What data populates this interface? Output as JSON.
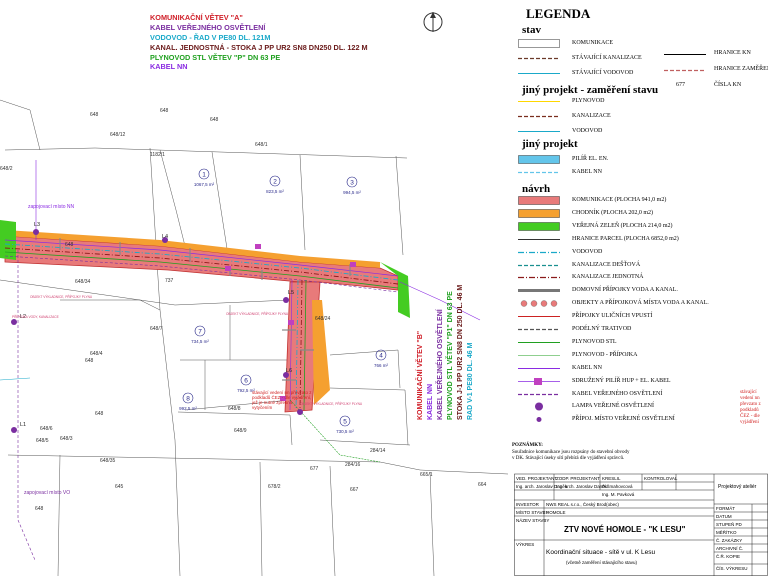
{
  "title_lines": [
    {
      "text": "KOMUNIKAČNÍ VĚTEV \"A\"",
      "color": "#d0202a"
    },
    {
      "text": "KABEL VEŘEJNÉHO OSVĚTLENÍ",
      "color": "#7a2ea0"
    },
    {
      "text": "VODOVOD - ŘAD V PE80 DL. 121M",
      "color": "#1aa9c9"
    },
    {
      "text": "KANAL. JEDNOSTNÁ - STOKA J PP UR2 SN8 DN250 DL. 122 M",
      "color": "#6a1a1a"
    },
    {
      "text": "PLYNOVOD STL VĚTEV \"P\" DN 63 PE",
      "color": "#20a020"
    },
    {
      "text": "KABEL NN",
      "color": "#8a2be2"
    }
  ],
  "vertical_lines": [
    {
      "text": "KOMUNIKAČNÍ VĚTEV \"B\"",
      "color": "#d0202a"
    },
    {
      "text": "KABEL NN",
      "color": "#8a2be2"
    },
    {
      "text": "KABEL VEŘEJNÉHO OSVĚTLENÍ",
      "color": "#7a2ea0"
    },
    {
      "text": "PLYNOVOD STL VĚTEV \"P1\" DN 63 PE",
      "color": "#20a020"
    },
    {
      "text": "STOKA J-1 PP UR2 SN8 DN 250 DL. 46 M",
      "color": "#6a1a1a"
    },
    {
      "text": "RAD V-1 PE80 DL. 46 M",
      "color": "#1aa9c9"
    }
  ],
  "plots": [
    {
      "num": "1",
      "area": "1067,5 m²"
    },
    {
      "num": "2",
      "area": "823,5 m²"
    },
    {
      "num": "3",
      "area": "994,5 m²"
    },
    {
      "num": "4",
      "area": "766 m²"
    },
    {
      "num": "5",
      "area": "730,5 m²"
    },
    {
      "num": "6",
      "area": "792,5 m²"
    },
    {
      "num": "7",
      "area": "734,5 m²"
    },
    {
      "num": "8",
      "area": "992,5 m²"
    }
  ],
  "parcel_labels": [
    "648",
    "648",
    "1182/1",
    "648/12",
    "648/2",
    "648",
    "648/1",
    "648",
    "648/34",
    "648/7",
    "648/4",
    "648/3",
    "737",
    "648/24",
    "648",
    "648/35",
    "648",
    "648/8",
    "648/9",
    "678/2",
    "677",
    "665/1",
    "664",
    "648/6",
    "648/5",
    "284/16",
    "284/14",
    "667",
    "648",
    "645"
  ],
  "map_notes": {
    "nn_top": "zapojovací místo NN",
    "vo_bottom": "zapojovací místo VO",
    "l_labels": [
      "L1",
      "L2",
      "L3",
      "L4",
      "L5",
      "L6"
    ],
    "red_note": "stávající vedení nn převzato z podkladů ČEZ - dle vyjádření, jež je nutné zpřesnit vytyčením",
    "pink1": "OBJEKT VÝKLADNICE, PŘÍPOJKY PLYNU",
    "pink2": "OBJEKT VÝKLADNICE, PŘÍPOJKY PLYNU",
    "pink3": "PŘÍPOJKA VODY, KANALIZACE",
    "pink4": "OBJEKT VÝKLADNICE, PŘÍPOJKY PLYNU"
  },
  "legend": {
    "title": "LEGENDA",
    "sec_stav": "stav",
    "stav": [
      {
        "label": "KOMUNIKACE",
        "color": "#ffffff",
        "border": "#333",
        "style": "box"
      },
      {
        "label": "STÁVAJÍCÍ KANALIZACE",
        "color": "#6b3a2a",
        "style": "dash"
      },
      {
        "label": "STÁVAJÍCÍ VODOVOD",
        "color": "#1aa9c9",
        "style": "line"
      }
    ],
    "stav_side": [
      {
        "label": "HRANICE KN",
        "color": "#000",
        "style": "line"
      },
      {
        "label": "HRANICE ZAMĚŘENÍ",
        "color": "#c06060",
        "style": "dash"
      },
      {
        "label": "ČÍSLA KN",
        "sample": "677"
      }
    ],
    "sec_jiny": "jiný projekt - zaměření stavu",
    "jiny": [
      {
        "label": "PLYNOVOD",
        "color": "#ffd700",
        "style": "line"
      },
      {
        "label": "KANALIZACE",
        "color": "#7a2e1e",
        "style": "dash"
      },
      {
        "label": "VODOVOD",
        "color": "#1aa9c9",
        "style": "line"
      }
    ],
    "sec_jiny2": "jiný projekt",
    "jiny2": [
      {
        "label": "PILÍŘ EL. EN.",
        "color": "#63c5ea",
        "style": "box"
      },
      {
        "label": "KABEL NN",
        "color": "#63c5ea",
        "style": "dash"
      }
    ],
    "sec_navrh": "návrh",
    "navrh": [
      {
        "label": "KOMUNIKACE (PLOCHA 941,0 m2)",
        "color": "#e87a7a",
        "style": "box"
      },
      {
        "label": "CHODNÍK (PLOCHA 202,0 m2)",
        "color": "#f5a030",
        "style": "box"
      },
      {
        "label": "VEŘEJNÁ ZELEŇ (PLOCHA 214,0 m2)",
        "color": "#44cc22",
        "style": "box"
      },
      {
        "label": "HRANICE PARCEL (PLOCHA 6852,0 m2)",
        "color": "#333",
        "style": "line"
      },
      {
        "label": "VODOVOD",
        "color": "#1aa9c9",
        "style": "dashdot"
      },
      {
        "label": "KANALIZACE DEŠŤOVÁ",
        "color": "#1a9090",
        "style": "dash"
      },
      {
        "label": "KANALIZACE JEDNOTNÁ",
        "color": "#8b1a1a",
        "style": "dashdot"
      },
      {
        "label": "DOMOVNÍ PŘÍPOJKY VODA A KANAL.",
        "color": "#777",
        "style": "thick"
      },
      {
        "label": "OBJEKTY A PŘÍPOJKOVÁ MÍSTA VODA A KANAL.",
        "color": "#e87a7a",
        "style": "circles"
      },
      {
        "label": "PŘÍPOJKY ULIČNÍCH VPUSTÍ",
        "color": "#cc2222",
        "style": "line"
      },
      {
        "label": "PODÉLNÝ TRATIVOD",
        "color": "#555",
        "style": "dash"
      },
      {
        "label": "PLYNOVOD STL",
        "color": "#20a020",
        "style": "line"
      },
      {
        "label": "PLYNOVOD - PŘÍPOJKA",
        "color": "#20a020",
        "style": "thin"
      },
      {
        "label": "KABEL NN",
        "color": "#8a2be2",
        "style": "line"
      },
      {
        "label": "SDRUŽENÝ PILÍŘ HUP + EL. KABEL",
        "color": "#c040c0",
        "style": "pilir"
      },
      {
        "label": "KABEL VEŘEJNÉHO OSVĚTLENÍ",
        "color": "#7a2ea0",
        "style": "dash"
      },
      {
        "label": "LAMPA VEŘEJNÉ OSVĚTLENÍ",
        "color": "#7a2ea0",
        "style": "lamp"
      },
      {
        "label": "PŘÍPOJ. MÍSTO VEŘEJNÉ OSVĚTLENÍ",
        "color": "#7a2ea0",
        "style": "dot"
      }
    ],
    "side_note": "stávající vedení nn převzato z podkladů ČEZ - dle vyjádření",
    "poznamky_title": "POZNÁMKY:",
    "poznamky": "Souřadnice komunikace jsou rozpsány do stavební obvody v DK. Stávající úseky sítí přebírá dle vyjádření správců."
  },
  "title_block": {
    "h1": "VED. PROJEKTANT",
    "h2": "ZODP. PROJEKTANT",
    "h3": "KRESLIL",
    "h4": "KONTROLOVAL",
    "n1": "Ing. arch. Jaroslav Daněk",
    "n2": "Ing. arch. Jaroslav Daněk",
    "n3": "D.Šmahovcová",
    "n4": "Ing. M. Pavková",
    "r_investor": "INVESTOR",
    "v_investor": "NWS REAL s.r.o., Český Brod(obec)",
    "r_misto": "MÍSTO STAVBY",
    "v_misto": "HOMOLE",
    "r_nazev": "NÁZEV STAVBY",
    "project": "ZTV NOVÉ HOMOLE - \"K LESU\"",
    "r_vykres": "VÝKRES",
    "drawing": "Koordinační situace - sítě v ul. K Lesu",
    "drawing_sub": "(včetně zaměření stávajícího stavu)",
    "right": [
      "FORMÁT",
      "DATUM",
      "STUPEŇ PD",
      "MĚŘÍTKO",
      "Č. ZAKÁZKY",
      "ARCHIVNÍ Č.",
      "Č.Ř. KOPIE",
      "ČÍS. VÝKRESU"
    ],
    "firm": "Projektový ateliér"
  },
  "colors": {
    "road": "#e87a7a",
    "walk": "#f5a030",
    "green": "#44cc22",
    "road_edge": "#c03030",
    "water": "#1aa9c9",
    "sewer": "#8b1a1a",
    "gas": "#20a020",
    "nn": "#8a2be2",
    "vo": "#7a2ea0"
  }
}
